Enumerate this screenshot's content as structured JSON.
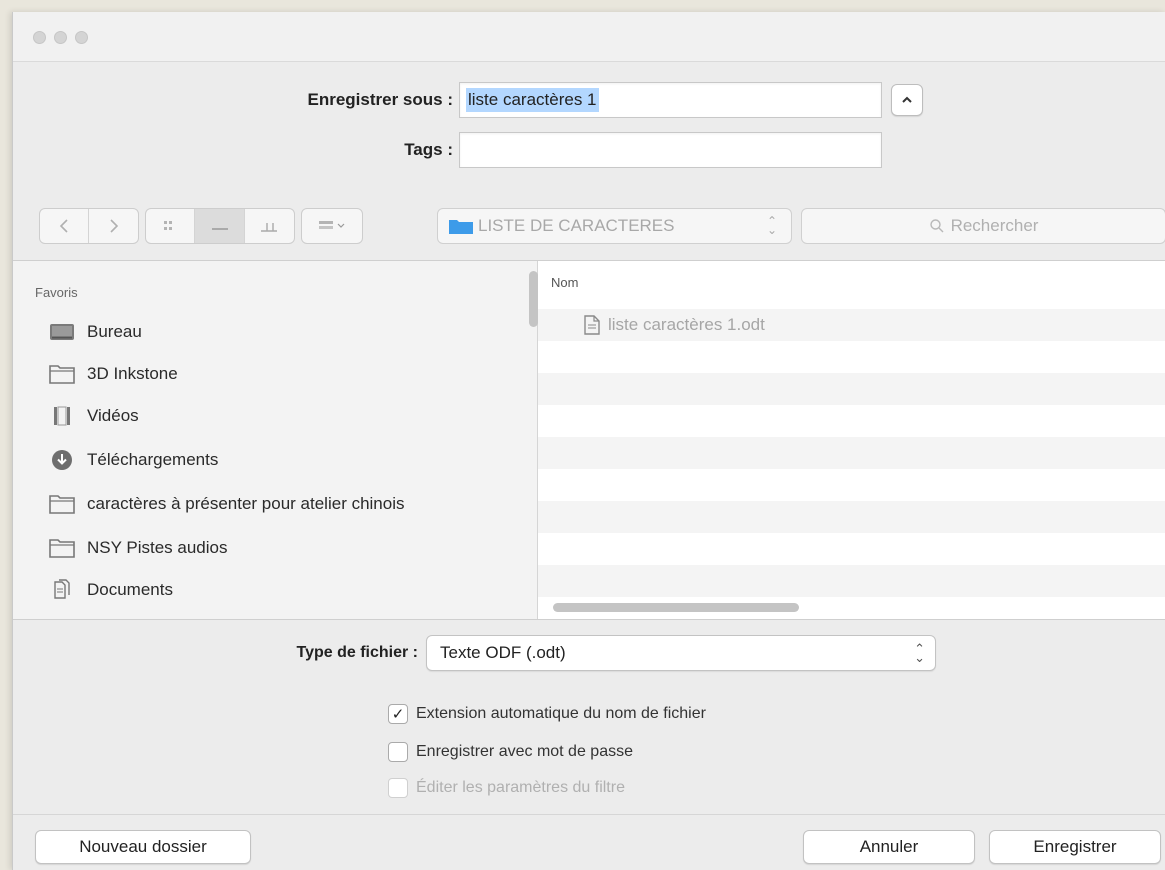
{
  "dialog": {
    "save_as_label": "Enregistrer sous :",
    "save_as_value": "liste caractères 1",
    "tags_label": "Tags :",
    "tags_value": "",
    "expand_icon": "chevron-up-icon"
  },
  "toolbar": {
    "back_icon": "chevron-left-icon",
    "forward_icon": "chevron-right-icon",
    "view_icons": [
      "icon-view-icon",
      "list-view-icon",
      "column-view-icon"
    ],
    "group_icon": "group-by-icon",
    "location": "LISTE DE CARACTERES",
    "search_placeholder": "Rechercher"
  },
  "sidebar": {
    "header": "Favoris",
    "items": [
      {
        "label": "Bureau",
        "icon": "desktop-icon"
      },
      {
        "label": "3D Inkstone",
        "icon": "folder-icon"
      },
      {
        "label": "Vidéos",
        "icon": "film-icon"
      },
      {
        "label": "Téléchargements",
        "icon": "download-icon"
      },
      {
        "label": "caractères à présenter pour atelier chinois",
        "icon": "folder-icon"
      },
      {
        "label": "NSY Pistes audios",
        "icon": "folder-icon"
      },
      {
        "label": "Documents",
        "icon": "documents-icon"
      }
    ]
  },
  "file_list": {
    "column_name": "Nom",
    "files": [
      {
        "name": "liste caractères 1.odt",
        "icon": "document-icon"
      }
    ]
  },
  "options": {
    "file_type_label": "Type de fichier :",
    "file_type_value": "Texte ODF (.odt)",
    "checkboxes": [
      {
        "label": "Extension automatique du nom de fichier",
        "checked": true,
        "enabled": true
      },
      {
        "label": "Enregistrer avec mot de passe",
        "checked": false,
        "enabled": true
      },
      {
        "label": "Éditer les paramètres du filtre",
        "checked": false,
        "enabled": false
      }
    ]
  },
  "footer": {
    "new_folder": "Nouveau dossier",
    "cancel": "Annuler",
    "save": "Enregistrer"
  },
  "colors": {
    "folder_accent": "#3d9be9",
    "selection": "#b3d7ff"
  }
}
